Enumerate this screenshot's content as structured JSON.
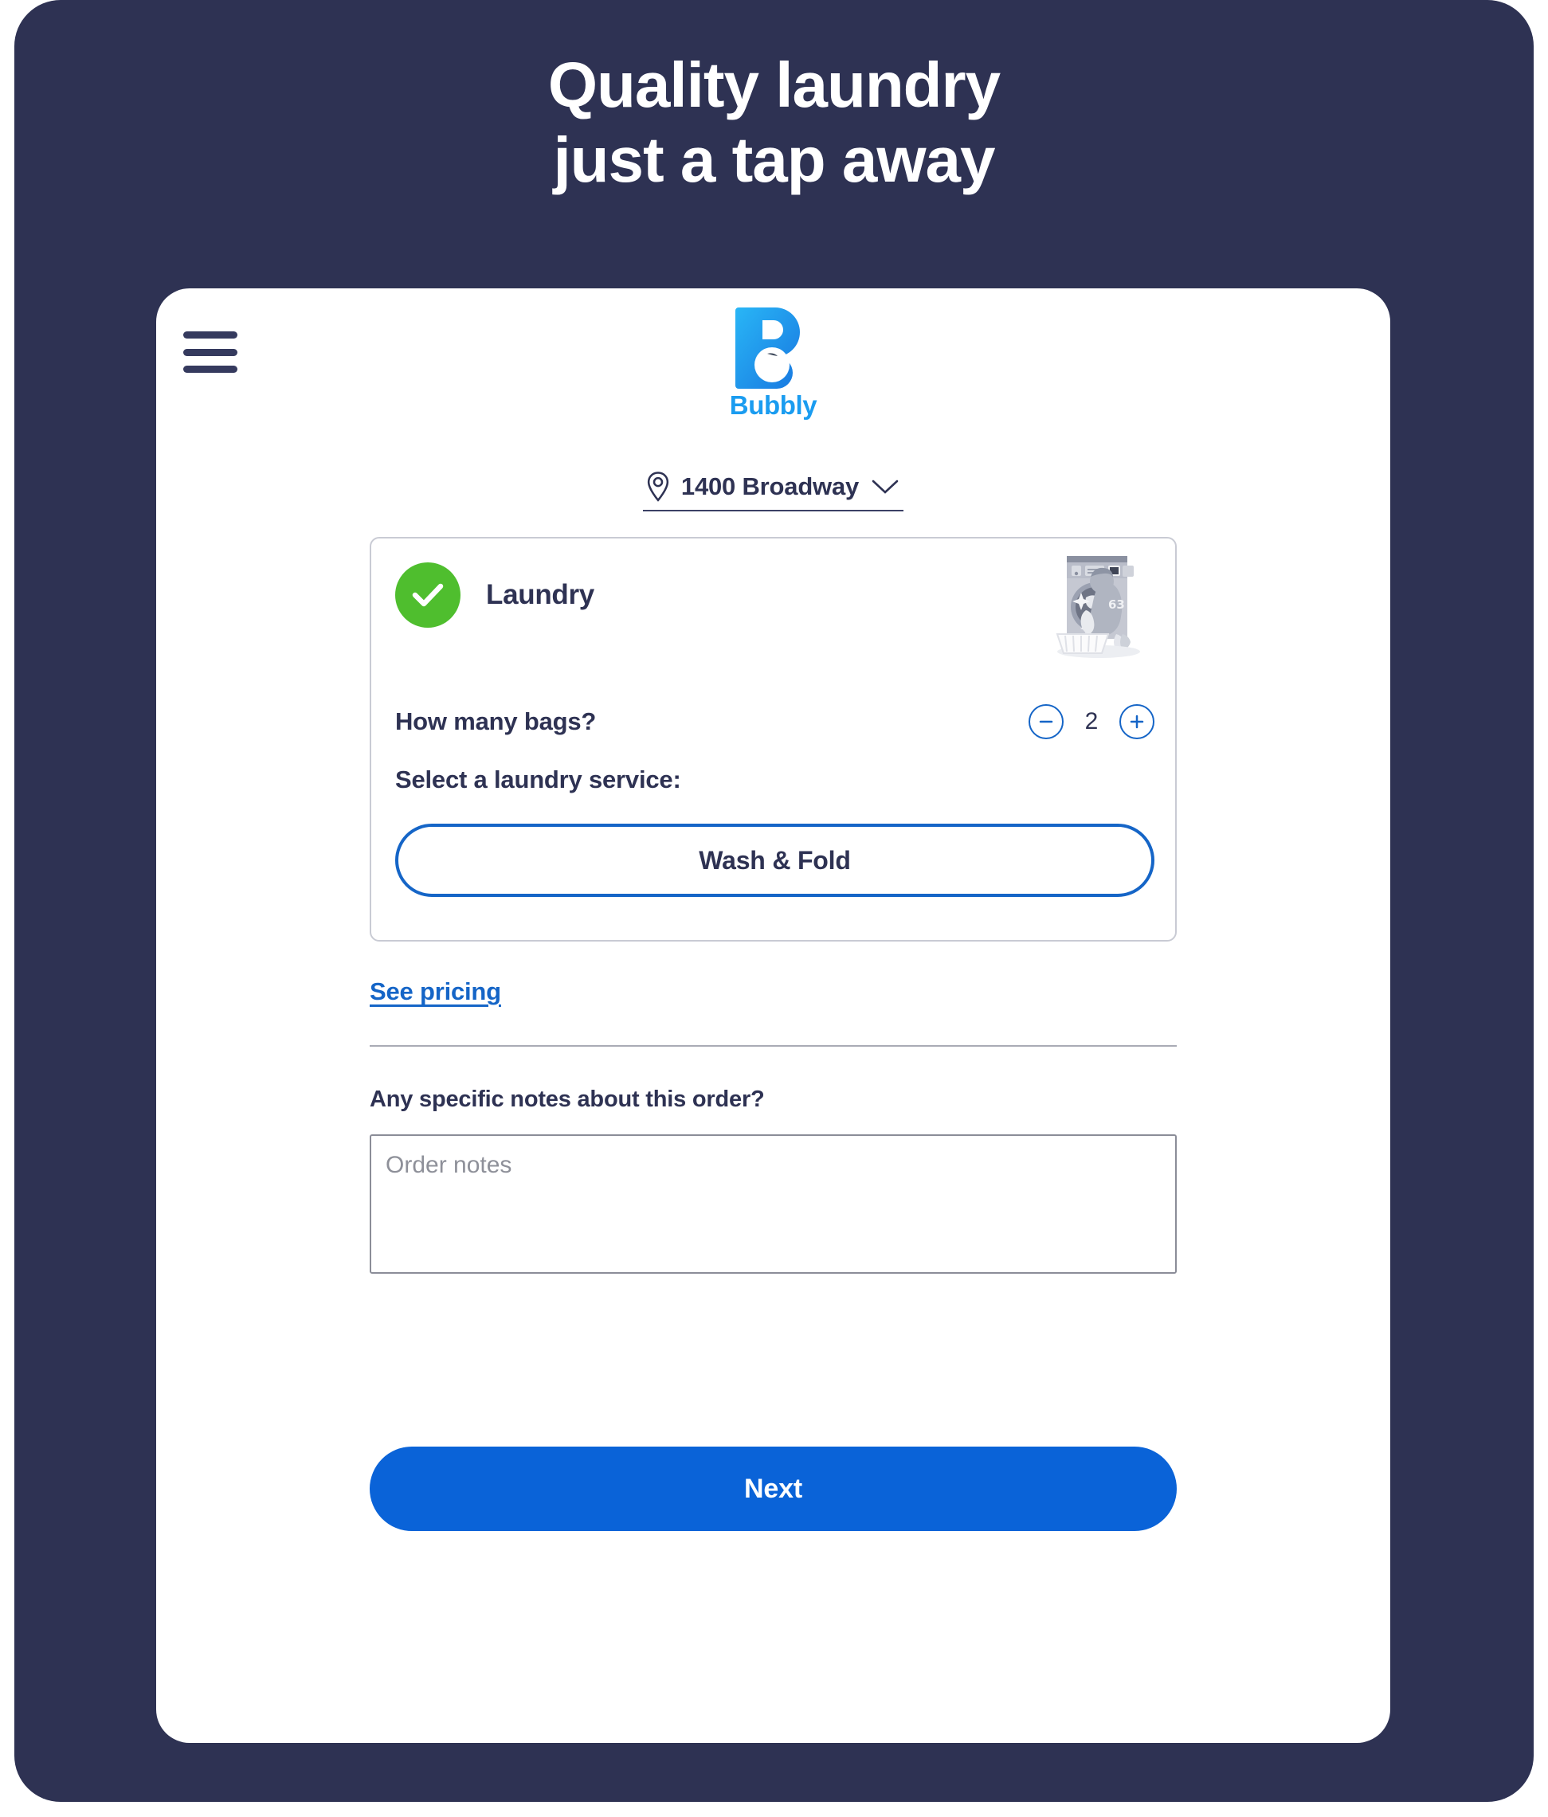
{
  "promo": {
    "headline_line1": "Quality laundry",
    "headline_line2": "just a tap away",
    "background_color": "#2e3253",
    "text_color": "#ffffff"
  },
  "app": {
    "menu_icon": "hamburger-menu-icon",
    "logo": {
      "mark_icon": "bubbly-b-logo-icon",
      "wordmark": "Bubbly",
      "color": "#1a9cf0"
    },
    "location": {
      "pin_icon": "map-pin-icon",
      "label": "1400 Broadway",
      "chevron_icon": "chevron-down-icon"
    },
    "service_card": {
      "selected_icon": "check-circle-icon",
      "selected_color": "#4fbe2e",
      "title": "Laundry",
      "illustration": "washing-machine-illustration",
      "bags_label": "How many bags?",
      "bags_value": "2",
      "decrement_icon": "minus-circle-icon",
      "increment_icon": "plus-circle-icon",
      "select_service_label": "Select a laundry service:",
      "service_options": [
        {
          "label": "Wash & Fold",
          "selected": true
        }
      ]
    },
    "pricing_link": "See pricing",
    "notes": {
      "label": "Any specific notes about this order?",
      "placeholder": "Order notes",
      "value": ""
    },
    "next_label": "Next",
    "accent_color": "#0a63d8",
    "outline_color": "#1565c7",
    "text_color": "#2e3253"
  }
}
